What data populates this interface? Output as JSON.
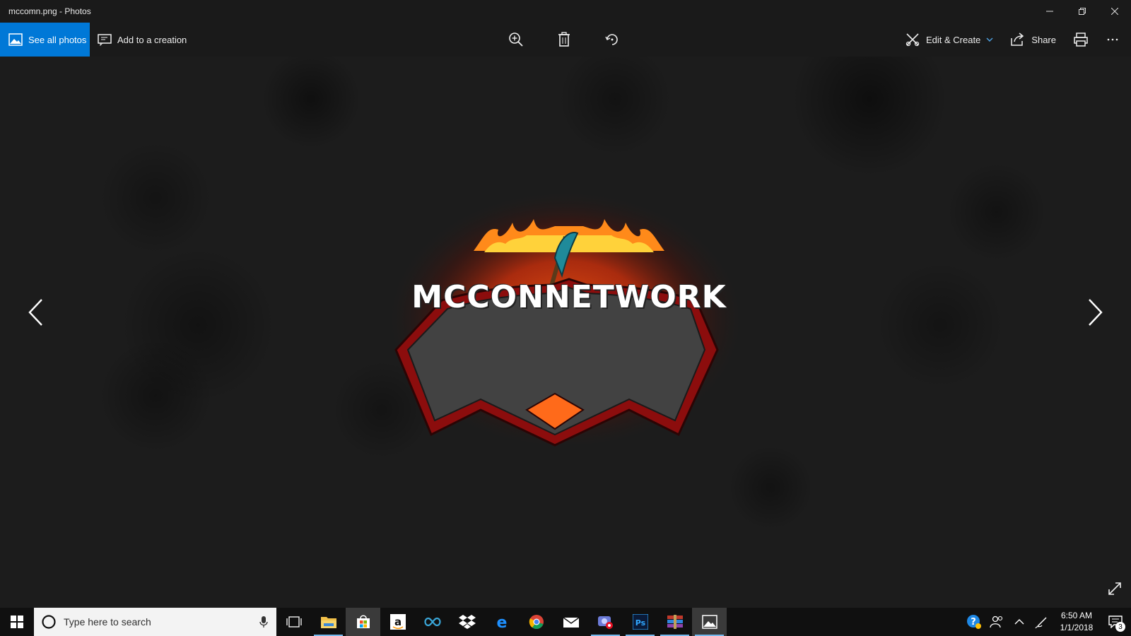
{
  "window": {
    "title": "mccomn.png - Photos"
  },
  "toolbar": {
    "see_all_photos": "See all photos",
    "add_to_creation": "Add to a creation",
    "edit_create": "Edit & Create",
    "share": "Share"
  },
  "image": {
    "logo_text": "MCCONNETWORK"
  },
  "taskbar": {
    "search_placeholder": "Type here to search",
    "time": "6:50 AM",
    "date": "1/1/2018",
    "notification_count": "3"
  },
  "colors": {
    "accent": "#0078d7",
    "background": "#1a1a1a",
    "taskbar": "#101010"
  }
}
